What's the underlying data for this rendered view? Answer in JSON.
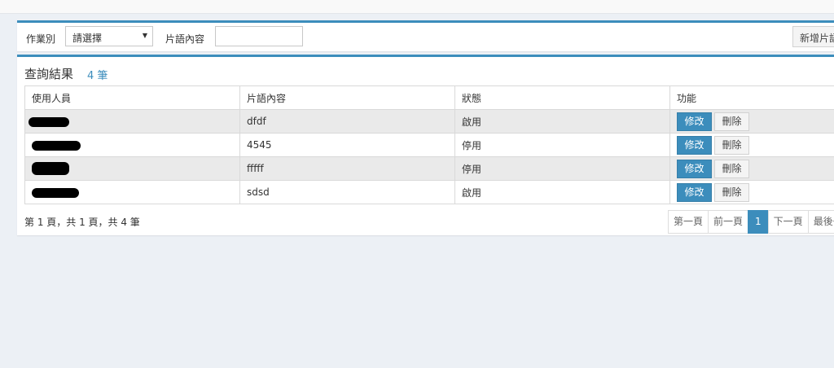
{
  "filter": {
    "category_label": "作業別",
    "category_select": "請選擇",
    "snippet_label": "片語內容",
    "snippet_value": "",
    "add_button": "新增片語"
  },
  "results": {
    "title": "查詢結果",
    "count": "4 筆",
    "columns": [
      "使用人員",
      "片語內容",
      "狀態",
      "功能"
    ],
    "rows": [
      {
        "user": "",
        "content": "dfdf",
        "status": "啟用"
      },
      {
        "user": "",
        "content": "4545",
        "status": "停用"
      },
      {
        "user": "",
        "content": "fffff",
        "status": "停用"
      },
      {
        "user": "",
        "content": "sdsd",
        "status": "啟用"
      }
    ],
    "edit_label": "修改",
    "delete_label": "刪除"
  },
  "pagination": {
    "info": "第 1 頁，共 1 頁，共 4 筆",
    "first": "第一頁",
    "prev": "前一頁",
    "current": "1",
    "next": "下一頁",
    "last": "最後一頁"
  },
  "colors": {
    "accent": "#3c8dbc",
    "background": "#ecf0f5"
  }
}
